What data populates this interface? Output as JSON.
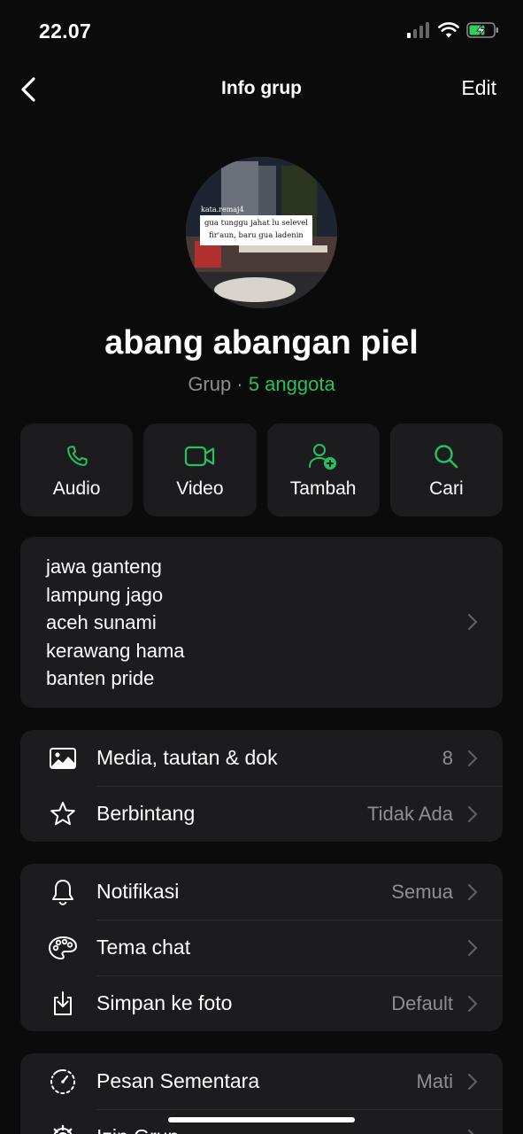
{
  "status_bar": {
    "time": "22.07"
  },
  "nav": {
    "title": "Info grup",
    "edit_label": "Edit"
  },
  "avatar": {
    "watermark": "kata.remaj4",
    "caption_line1": "gua tunggu jahat lu selevel",
    "caption_line2": "fir'aun, baru gua ladenin"
  },
  "group": {
    "name": "abang abangan piel",
    "type_label": "Grup",
    "separator": "·",
    "members_label": "5 anggota"
  },
  "actions": [
    {
      "label": "Audio",
      "icon": "phone-icon"
    },
    {
      "label": "Video",
      "icon": "video-icon"
    },
    {
      "label": "Tambah",
      "icon": "add-person-icon"
    },
    {
      "label": "Cari",
      "icon": "search-icon"
    }
  ],
  "description": {
    "lines": [
      "jawa ganteng",
      "lampung jago",
      "aceh sunami",
      "kerawang hama",
      "banten pride"
    ]
  },
  "media_section": [
    {
      "label": "Media, tautan & dok",
      "value": "8",
      "icon": "photo-icon"
    },
    {
      "label": "Berbintang",
      "value": "Tidak Ada",
      "icon": "star-icon"
    }
  ],
  "settings_section": [
    {
      "label": "Notifikasi",
      "value": "Semua",
      "icon": "bell-icon"
    },
    {
      "label": "Tema chat",
      "value": "",
      "icon": "palette-icon"
    },
    {
      "label": "Simpan ke foto",
      "value": "Default",
      "icon": "download-icon"
    }
  ],
  "privacy_section": [
    {
      "label": "Pesan Sementara",
      "value": "Mati",
      "icon": "timer-icon"
    },
    {
      "label": "Izin Grup",
      "value": "",
      "icon": "gear-icon"
    }
  ],
  "colors": {
    "accent": "#25c25f",
    "card": "#1c1c1e",
    "background": "#0b0b0b",
    "secondary_text": "#8e8e93"
  }
}
